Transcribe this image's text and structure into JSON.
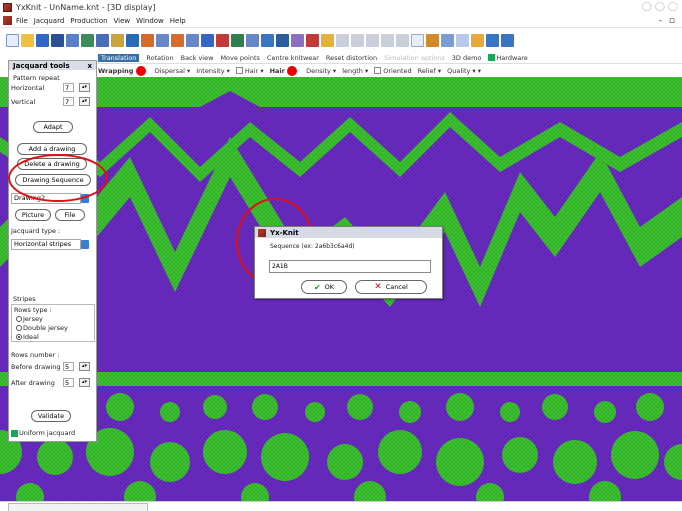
{
  "window": {
    "title": "YxKnit - UnName.knt - [3D display]"
  },
  "menu": [
    "File",
    "Jacquard",
    "Production",
    "View",
    "Window",
    "Help"
  ],
  "subbar1": {
    "items": [
      "Rotation",
      "Back view",
      "Move points",
      "Centre knitwear",
      "Reset distortion",
      "Simulation options",
      "3D demo"
    ],
    "active_partial": "Translation",
    "hardware_label": "Hardware"
  },
  "subbar2": {
    "wrapping": "Wrapping",
    "dispersal": "Dispersal",
    "intensity": "Intensity",
    "hair1": "Hair",
    "hair2": "Hair",
    "density": "Density",
    "length": "length",
    "oriented": "Oriented",
    "relief": "Relief",
    "quality": "Quality"
  },
  "panel": {
    "title": "Jacquard tools",
    "close": "x",
    "pattern_repeat": "Pattern repeat",
    "horizontal_label": "Horizontal",
    "horizontal_value": "7",
    "vertical_label": "Vertical",
    "vertical_value": "7",
    "adapt": "Adapt",
    "add_drawing": "Add a drawing",
    "delete_drawing": "Delete a drawing",
    "drawing_sequence": "Drawing Sequence",
    "drawing_select": "Drawing2",
    "picture": "Picture",
    "file": "File",
    "jacquard_type_label": "Jacquard type :",
    "jacquard_type_value": "Horizontal stripes",
    "stripes_title": "Stripes",
    "rows_type_label": "Rows type :",
    "rows_type_options": [
      "Jersey",
      "Double jersey",
      "Ideal"
    ],
    "rows_type_selected": "Ideal",
    "rows_number_label": "Rows number :",
    "before_label": "Before drawing",
    "before_value": "5",
    "after_label": "After drawing",
    "after_value": "5",
    "validate": "Validate",
    "uniform": "Uniform jacquard"
  },
  "dialog": {
    "title": "Yx-Knit",
    "sequence_label": "Sequence (ex: 2a6b3c6a4d)",
    "sequence_value": "2A1B",
    "ok": "OK",
    "cancel": "Cancel"
  },
  "colors": {
    "knit_purple": "#6a2bc4",
    "knit_green": "#3bc42f",
    "annotation_red": "#e01010"
  }
}
